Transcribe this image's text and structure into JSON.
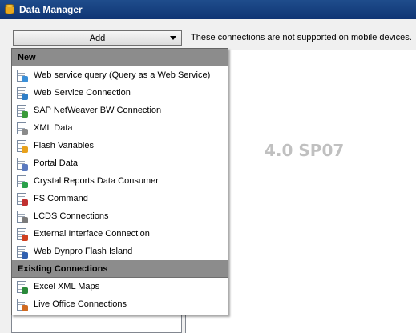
{
  "window": {
    "title": "Data Manager"
  },
  "toolbar": {
    "add_label": "Add",
    "notice": "These connections are not supported on mobile devices."
  },
  "preview": {
    "version_text": "4.0 SP07"
  },
  "menu": {
    "group_new": "New",
    "new_items": [
      {
        "label": "Web service query (Query as a Web Service)",
        "icon": "web-service-query-icon",
        "badge": "#3a8fd8"
      },
      {
        "label": "Web Service Connection",
        "icon": "web-service-connection-icon",
        "badge": "#2f7fc8"
      },
      {
        "label": "SAP NetWeaver BW Connection",
        "icon": "sap-netweaver-bw-icon",
        "badge": "#3a9a3a"
      },
      {
        "label": "XML Data",
        "icon": "xml-data-icon",
        "badge": "#8a8a8a"
      },
      {
        "label": "Flash Variables",
        "icon": "flash-variables-icon",
        "badge": "#e8a11c"
      },
      {
        "label": "Portal Data",
        "icon": "portal-data-icon",
        "badge": "#5a7ac0"
      },
      {
        "label": "Crystal Reports Data Consumer",
        "icon": "crystal-reports-icon",
        "badge": "#2aa04a"
      },
      {
        "label": "FS Command",
        "icon": "fs-command-icon",
        "badge": "#c03030"
      },
      {
        "label": "LCDS Connections",
        "icon": "lcds-connections-icon",
        "badge": "#7a7a7a"
      },
      {
        "label": "External Interface Connection",
        "icon": "external-interface-icon",
        "badge": "#d04020"
      },
      {
        "label": "Web Dynpro Flash Island",
        "icon": "web-dynpro-icon",
        "badge": "#3060b0"
      }
    ],
    "group_existing": "Existing Connections",
    "existing_items": [
      {
        "label": "Excel XML Maps",
        "icon": "excel-xml-maps-icon",
        "badge": "#2a8a3a"
      },
      {
        "label": "Live Office Connections",
        "icon": "live-office-icon",
        "badge": "#d06a20"
      }
    ]
  }
}
